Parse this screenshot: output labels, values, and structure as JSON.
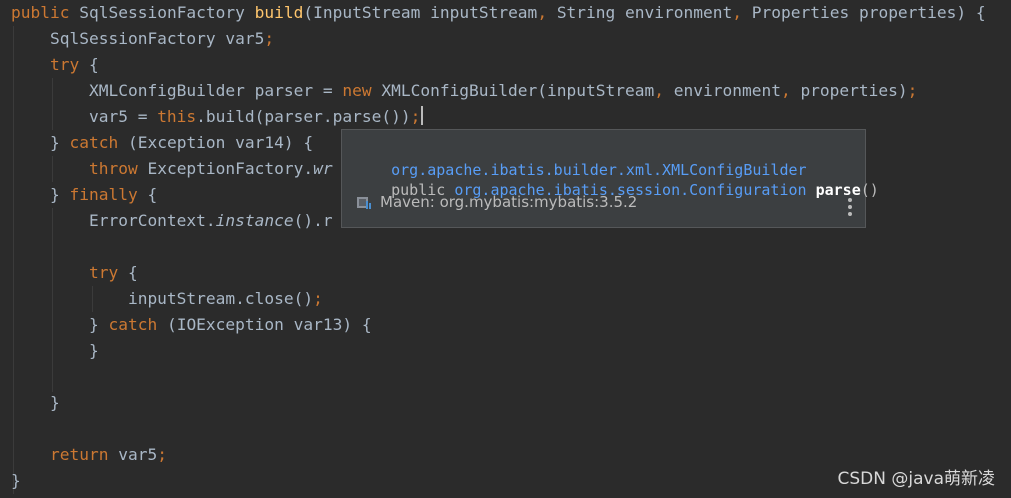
{
  "code_lines": [
    {
      "segments": [
        {
          "t": "public ",
          "c": "kw"
        },
        {
          "t": "SqlSessionFactory "
        },
        {
          "t": "build",
          "c": "fn"
        },
        {
          "t": "(InputStream inputStream"
        },
        {
          "t": ", ",
          "c": "kw"
        },
        {
          "t": "String environment"
        },
        {
          "t": ", ",
          "c": "kw"
        },
        {
          "t": "Properties properties) {"
        }
      ]
    },
    {
      "segments": [
        {
          "t": "    SqlSessionFactory var5"
        },
        {
          "t": ";",
          "c": "kw"
        }
      ]
    },
    {
      "segments": [
        {
          "t": "    "
        },
        {
          "t": "try",
          "c": "kw"
        },
        {
          "t": " {"
        }
      ]
    },
    {
      "segments": [
        {
          "t": "        XMLConfigBuilder parser = "
        },
        {
          "t": "new ",
          "c": "kw"
        },
        {
          "t": "XMLConfigBuilder(inputStream"
        },
        {
          "t": ", ",
          "c": "kw"
        },
        {
          "t": "environment"
        },
        {
          "t": ", ",
          "c": "kw"
        },
        {
          "t": "properties)"
        },
        {
          "t": ";",
          "c": "kw"
        }
      ]
    },
    {
      "segments": [
        {
          "t": "        var5 = "
        },
        {
          "t": "this",
          "c": "kw"
        },
        {
          "t": ".build(parser.parse())"
        },
        {
          "t": ";",
          "c": "kw"
        },
        {
          "caret": true
        }
      ]
    },
    {
      "segments": [
        {
          "t": "    } "
        },
        {
          "t": "catch",
          "c": "kw"
        },
        {
          "t": " (Exception var14) {"
        }
      ]
    },
    {
      "segments": [
        {
          "t": "        "
        },
        {
          "t": "throw ",
          "c": "kw"
        },
        {
          "t": "ExceptionFactory."
        },
        {
          "t": "wr",
          "c": "it"
        }
      ]
    },
    {
      "segments": [
        {
          "t": "    } "
        },
        {
          "t": "finally",
          "c": "kw"
        },
        {
          "t": " {"
        }
      ]
    },
    {
      "segments": [
        {
          "t": "        ErrorContext."
        },
        {
          "t": "instance",
          "c": "it"
        },
        {
          "t": "().r"
        }
      ]
    },
    {
      "segments": []
    },
    {
      "segments": [
        {
          "t": "        "
        },
        {
          "t": "try",
          "c": "kw"
        },
        {
          "t": " {"
        }
      ]
    },
    {
      "segments": [
        {
          "t": "            inputStream.close()"
        },
        {
          "t": ";",
          "c": "kw"
        }
      ]
    },
    {
      "segments": [
        {
          "t": "        } "
        },
        {
          "t": "catch",
          "c": "kw"
        },
        {
          "t": " (IOException var13) {"
        }
      ]
    },
    {
      "segments": [
        {
          "t": "        }"
        }
      ]
    },
    {
      "segments": []
    },
    {
      "segments": [
        {
          "t": "    }"
        }
      ]
    },
    {
      "segments": []
    },
    {
      "segments": [
        {
          "t": "    "
        },
        {
          "t": "return ",
          "c": "kw"
        },
        {
          "t": "var5"
        },
        {
          "t": ";",
          "c": "kw"
        }
      ]
    },
    {
      "segments": [
        {
          "t": "}"
        }
      ]
    }
  ],
  "quick_doc": {
    "class_name": "org.apache.ibatis.builder.xml.XMLConfigBuilder",
    "modifier": "public ",
    "return_type": "org.apache.ibatis.session.Configuration",
    "method_name": "parse",
    "params": "()",
    "library_icon": "library-jar-icon",
    "library": "Maven: org.mybatis:mybatis:3.5.2",
    "more_icon": "more-vertical-icon"
  },
  "watermark": "CSDN @java萌新凌",
  "colors": {
    "background": "#2b2b2b",
    "keyword": "#cc7832",
    "method": "#ffc66d",
    "text": "#a9b7c6",
    "link": "#589df6",
    "popup_background": "#3c3f41"
  }
}
